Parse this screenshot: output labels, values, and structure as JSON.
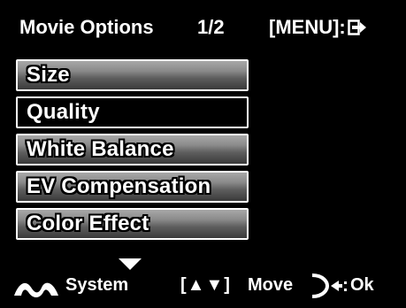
{
  "header": {
    "title": "Movie Options",
    "page_indicator": "1/2",
    "menu_hint": "[MENU]:",
    "exit_icon": "exit-arrow-icon"
  },
  "menu": {
    "items": [
      {
        "label": "Size",
        "selected": false
      },
      {
        "label": "Quality",
        "selected": true
      },
      {
        "label": "White Balance",
        "selected": false
      },
      {
        "label": "EV Compensation",
        "selected": false
      },
      {
        "label": "Color Effect",
        "selected": false
      }
    ]
  },
  "footer": {
    "system_label": "System",
    "move_symbol": "[▲▼]",
    "move_label": "Move",
    "ok_label": "Ok",
    "system_icon": "system-wave-icon",
    "scroll_icon": "down-triangle-icon",
    "ok_icon": "dial-left-icon"
  },
  "colors": {
    "background": "#000000",
    "text": "#ffffff",
    "button_gradient_top": "#a8a8a8",
    "button_gradient_bottom": "#3a3a3a",
    "selected_background": "#000000"
  }
}
